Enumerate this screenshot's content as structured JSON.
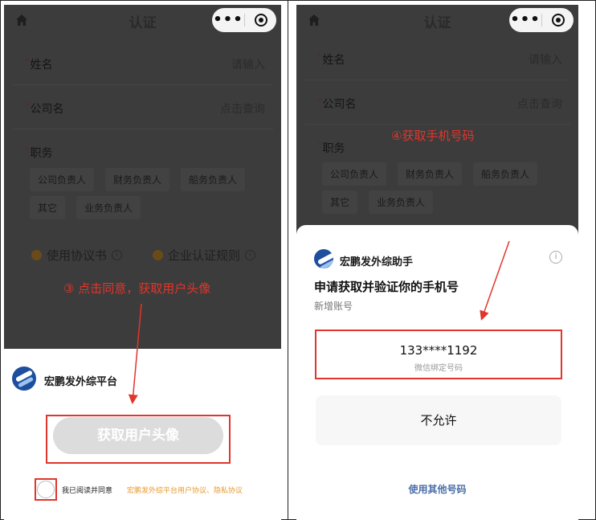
{
  "left_screen": {
    "nav_title": "认证",
    "capsule_more": "•••",
    "form": {
      "required_mark": "*",
      "name_label": "姓名",
      "name_placeholder": "请输入",
      "company_label": "公司名",
      "company_placeholder": "点击查询",
      "job_label": "职务",
      "job_options": [
        "公司负责人",
        "财务负责人",
        "船务负责人",
        "其它",
        "业务负责人"
      ]
    },
    "agreements": {
      "usage": "使用协议书",
      "rules": "企业认证规则",
      "info_glyph": "i"
    },
    "step_note": "③ 点击同意，获取用户头像",
    "sheet": {
      "app_name": "宏鹏发外综平台",
      "get_avatar_button": "获取用户头像",
      "agree_prefix": "我已阅读并同意",
      "agree_links": "宏鹏发外综平台用户协议、隐私协议"
    }
  },
  "right_screen": {
    "nav_title": "认证",
    "capsule_more": "•••",
    "form": {
      "required_mark": "*",
      "name_label": "姓名",
      "name_placeholder": "请输入",
      "company_label": "公司名",
      "company_placeholder": "点击查询",
      "job_label": "职务",
      "job_options": [
        "公司负责人",
        "财务负责人",
        "船务负责人",
        "其它",
        "业务负责人"
      ]
    },
    "step_note": "④获取手机号码",
    "sheet": {
      "app_name": "宏鹏发外综助手",
      "info_glyph": "i",
      "request_title": "申请获取并验证你的手机号",
      "request_subtitle": "新增账号",
      "phone_number": "133****1192",
      "phone_note": "微信绑定号码",
      "deny_button": "不允许",
      "use_other_number": "使用其他号码"
    }
  },
  "colors": {
    "overlay": "#3c3c3c",
    "annotation_red": "#e0362c",
    "link_orange": "#e89a2c",
    "link_blue": "#4a6ea8",
    "logo_blue": "#1d4f9e"
  },
  "icons": [
    "home-icon",
    "more-dots-icon",
    "target-icon",
    "info-icon",
    "app-logo-icon",
    "arrow-icon"
  ]
}
